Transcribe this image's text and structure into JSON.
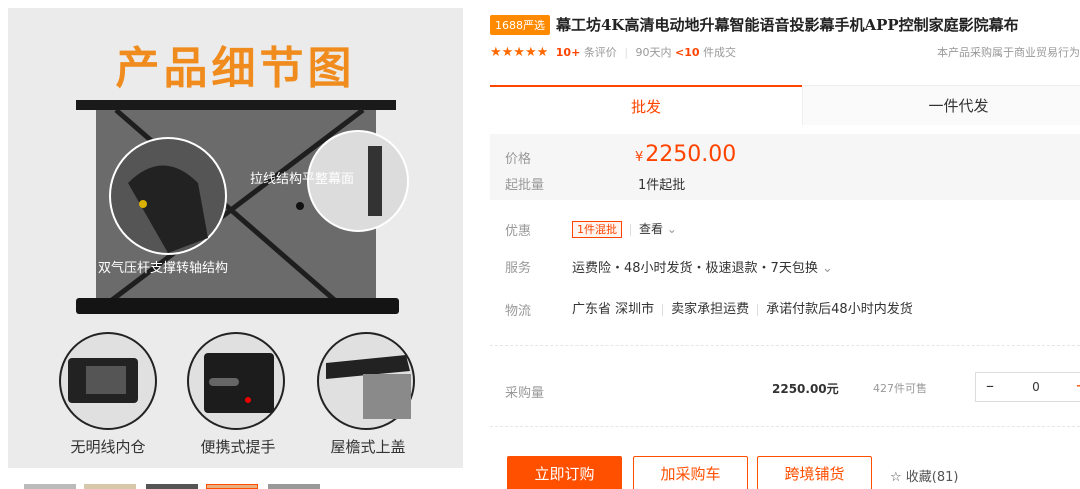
{
  "gallery": {
    "title": "产品细节图",
    "callouts": {
      "surface": "拉线结构平整幕面",
      "support": "双气压杆支撑转轴结构"
    },
    "features": [
      "无明线内仓",
      "便携式提手",
      "屋檐式上盖"
    ]
  },
  "product": {
    "badge": "1688严选",
    "title": "幕工坊4K高清电动地升幕智能语音投影幕手机APP控制家庭影院幕布",
    "stars": "★★★★★",
    "review_count": "10+",
    "review_label": "条评价",
    "sales_prefix": "90天内",
    "sales_count": "<10",
    "sales_label": "件成交",
    "biz_note": "本产品采购属于商业贸易行为"
  },
  "tabs": {
    "wholesale": "批发",
    "dropship": "一件代发"
  },
  "pricing": {
    "price_label": "价格",
    "currency": "¥",
    "price": "2250.00",
    "moq_label": "起批量",
    "moq": "1件起批"
  },
  "details": {
    "discount_label": "优惠",
    "discount_tag": "1件混批",
    "discount_link": "查看",
    "service_label": "服务",
    "service_text": "运费险・48小时发货・极速退款・7天包换",
    "logistics_label": "物流",
    "logistics_region": "广东省 深圳市",
    "logistics_fee": "卖家承担运费",
    "logistics_promise": "承诺付款后48小时内发货"
  },
  "purchase": {
    "qty_label": "采购量",
    "unit_price": "2250.00元",
    "stock": "427件可售",
    "qty": "0",
    "minus": "–",
    "plus": "+"
  },
  "actions": {
    "buy_now": "立即订购",
    "add_cart": "加采购车",
    "cross_border": "跨境铺货",
    "favorite": "☆ 收藏(81)"
  },
  "colors": {
    "accent": "#ff5000",
    "title_orange": "#f08c1e"
  }
}
